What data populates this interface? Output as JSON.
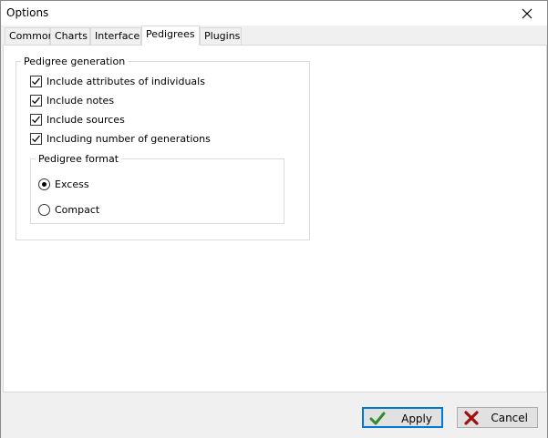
{
  "window": {
    "title": "Options"
  },
  "tabs": [
    {
      "label": "Common"
    },
    {
      "label": "Charts"
    },
    {
      "label": "Interface"
    },
    {
      "label": "Pedigrees"
    },
    {
      "label": "Plugins"
    }
  ],
  "active_tab": "Pedigrees",
  "pedigree_generation": {
    "title": "Pedigree generation",
    "options": [
      {
        "label": "Include attributes of individuals",
        "checked": true
      },
      {
        "label": "Include notes",
        "checked": true
      },
      {
        "label": "Include sources",
        "checked": true
      },
      {
        "label": "Including number of generations",
        "checked": true
      }
    ]
  },
  "pedigree_format": {
    "title": "Pedigree format",
    "options": [
      {
        "label": "Excess",
        "selected": true
      },
      {
        "label": "Compact",
        "selected": false
      }
    ]
  },
  "buttons": {
    "apply": "Apply",
    "cancel": "Cancel"
  },
  "colors": {
    "accent": "#0078d7",
    "apply_icon": "#2e8b2e",
    "cancel_icon": "#a01010"
  },
  "icons": {
    "close": "close-icon",
    "apply": "checkmark-icon",
    "cancel": "x-mark-icon"
  }
}
